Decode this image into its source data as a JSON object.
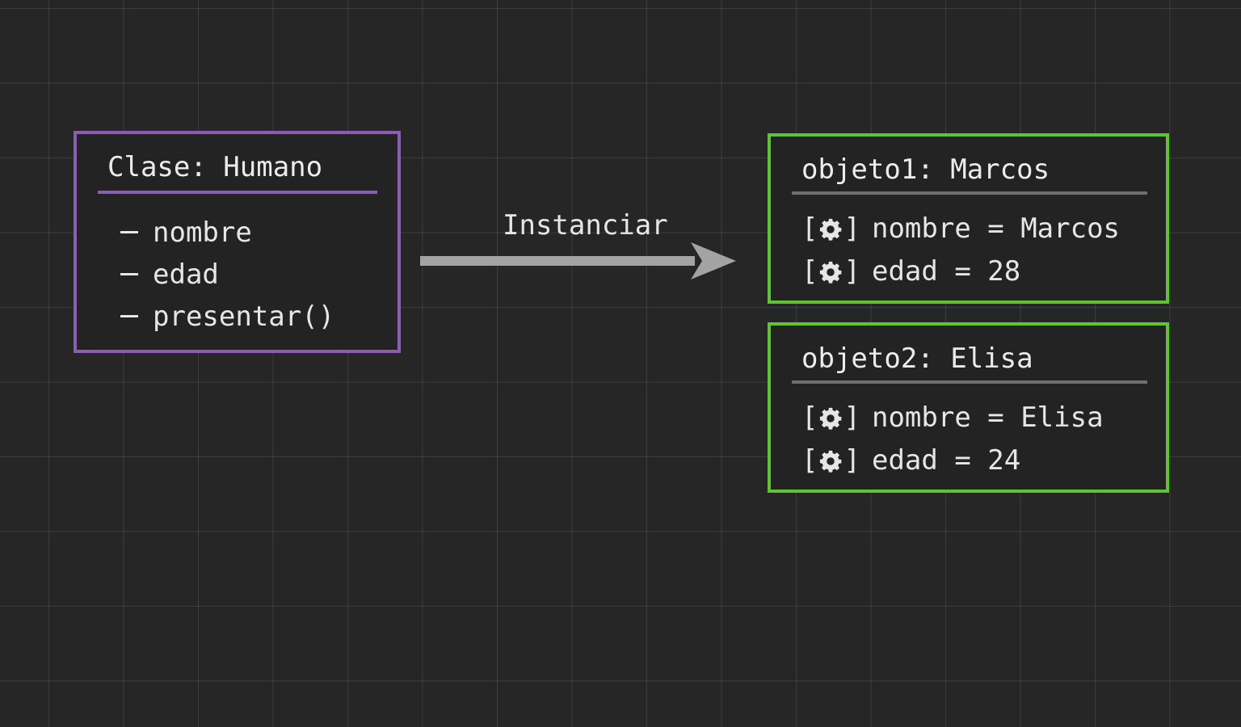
{
  "class_box": {
    "title": "Clase: Humano",
    "members": [
      "nombre",
      "edad",
      "presentar()"
    ],
    "border_color": "#8e5bb5"
  },
  "arrow": {
    "label": "Instanciar",
    "color": "#a3a3a3"
  },
  "objects": [
    {
      "title": "objeto1: Marcos",
      "attributes": [
        {
          "icon": "gear-icon",
          "text": "nombre = Marcos"
        },
        {
          "icon": "gear-icon",
          "text": "edad = 28"
        }
      ]
    },
    {
      "title": "objeto2: Elisa",
      "attributes": [
        {
          "icon": "gear-icon",
          "text": "nombre = Elisa"
        },
        {
          "icon": "gear-icon",
          "text": "edad = 24"
        }
      ]
    }
  ],
  "colors": {
    "background": "#262626",
    "object_border": "#5fc432",
    "divider": "#707070"
  }
}
